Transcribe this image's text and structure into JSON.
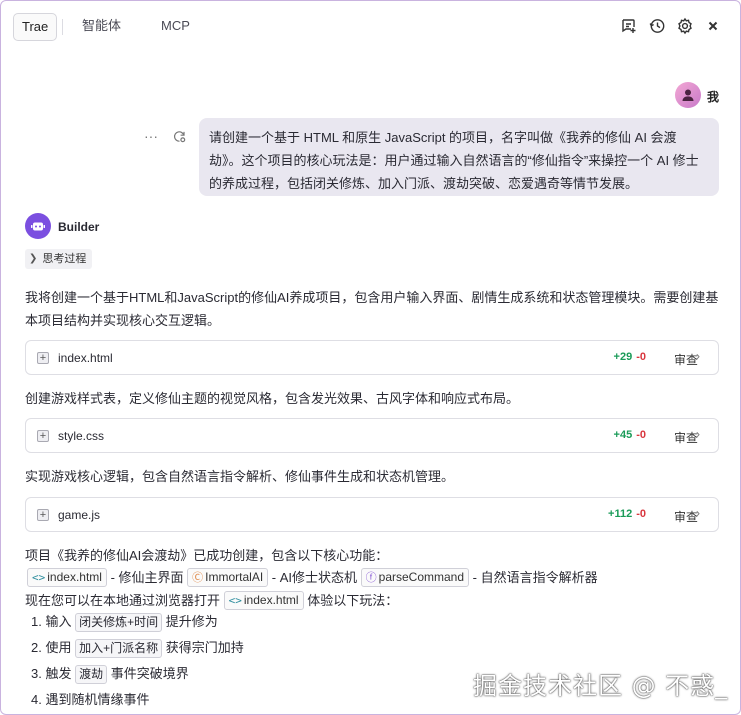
{
  "tabs": [
    {
      "label": "Trae",
      "active": true
    },
    {
      "label": "智能体",
      "active": false
    },
    {
      "label": "MCP",
      "active": false
    }
  ],
  "top_icons": [
    "new-chat-icon",
    "history-icon",
    "settings-gear-icon",
    "close-icon"
  ],
  "user": {
    "name": "我",
    "message": "请创建一个基于 HTML 和原生 JavaScript 的项目，名字叫做《我养的修仙 AI 会渡劫》。这个项目的核心玩法是：用户通过输入自然语言的“修仙指令”来操控一个 AI 修士的养成过程，包括闭关修炼、加入门派、渡劫突破、恋爱遇奇等情节发展。"
  },
  "bot": {
    "name": "Builder",
    "think_label": "思考过程"
  },
  "paragraphs": {
    "p1": "我将创建一个基于HTML和JavaScript的修仙AI养成项目，包含用户输入界面、剧情生成系统和状态管理模块。需要创建基本项目结构并实现核心交互逻辑。",
    "p2": "创建游戏样式表，定义修仙主题的视觉风格，包含发光效果、古风字体和响应式布局。",
    "p3": "实现游戏核心逻辑，包含自然语言指令解析、修仙事件生成和状态机管理。",
    "summary_intro": "项目《我养的修仙AI会渡劫》已成功创建，包含以下核心功能：",
    "summary_sep1": "- 修仙主界面",
    "summary_sep2": "- AI修士状态机",
    "summary_sep3": "- 自然语言指令解析器",
    "try_prefix": "现在您可以在本地通过浏览器打开",
    "try_suffix": "体验以下玩法："
  },
  "files": [
    {
      "name": "index.html",
      "added": "+29",
      "removed": "-0",
      "review": "审查"
    },
    {
      "name": "style.css",
      "added": "+45",
      "removed": "-0",
      "review": "审查"
    },
    {
      "name": "game.js",
      "added": "+112",
      "removed": "-0",
      "review": "审查"
    }
  ],
  "chips": {
    "index": "index.html",
    "immortal": "ImmortalAI",
    "parse": "parseCommand",
    "index2": "index.html"
  },
  "steps": [
    {
      "num": "1.",
      "pre": "输入",
      "code": "闭关修炼+时间",
      "post": "提升修为"
    },
    {
      "num": "2.",
      "pre": "使用",
      "code": "加入+门派名称",
      "post": "获得宗门加持"
    },
    {
      "num": "3.",
      "pre": "触发",
      "code": "渡劫",
      "post": "事件突破境界"
    },
    {
      "num": "4.",
      "pre": "遇到随机情缘事件",
      "code": "",
      "post": ""
    }
  ],
  "watermark": "掘金技术社区 @ 不惑_"
}
